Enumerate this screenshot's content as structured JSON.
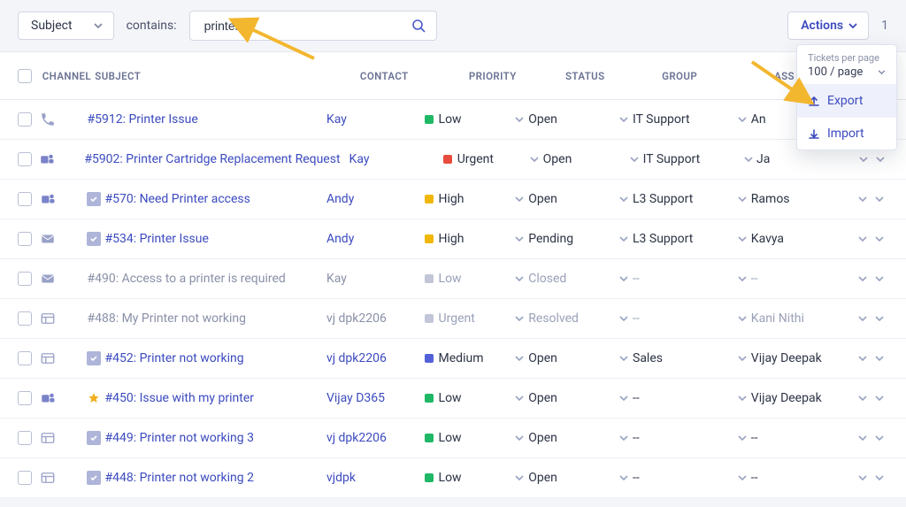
{
  "filter": {
    "field_value": "Subject",
    "operator_label": "contains:",
    "search_value": "printer",
    "search_placeholder": ""
  },
  "actions": {
    "button_label": "Actions",
    "page_counter": "1",
    "popup": {
      "tickets_per_page_label": "Tickets per page",
      "per_page_value": "100 / page",
      "export_label": "Export",
      "import_label": "Import"
    }
  },
  "headers": {
    "channel": "Channel",
    "subject": "Subject",
    "contact": "Contact",
    "priority": "Priority",
    "status": "Status",
    "group": "Group",
    "assigned": "Ass"
  },
  "priority_colors": {
    "Low": "#1fb866",
    "Urgent": "#e74c3c",
    "High": "#f1b708",
    "Medium": "#5261d8"
  },
  "rows": [
    {
      "channel": "phone",
      "lead": "none",
      "subject": "#5912: Printer Issue",
      "contact": "Kay",
      "priority": "Low",
      "status": "Open",
      "group": "IT Support",
      "assigned": "An",
      "muted": false
    },
    {
      "channel": "teams",
      "lead": "none",
      "subject": "#5902: Printer Cartridge Replacement Request",
      "contact": "Kay",
      "priority": "Urgent",
      "status": "Open",
      "group": "IT Support",
      "assigned": "Ja",
      "muted": false
    },
    {
      "channel": "teams",
      "lead": "check",
      "subject": "#570: Need Printer access",
      "contact": "Andy",
      "priority": "High",
      "status": "Open",
      "group": "L3 Support",
      "assigned": "Ramos",
      "muted": false
    },
    {
      "channel": "email",
      "lead": "check",
      "subject": "#534: Printer Issue",
      "contact": "Andy",
      "priority": "High",
      "status": "Pending",
      "group": "L3 Support",
      "assigned": "Kavya",
      "muted": false
    },
    {
      "channel": "email",
      "lead": "none",
      "subject": "#490: Access to a printer is required",
      "contact": "Kay",
      "priority": "Low",
      "status": "Closed",
      "group": "--",
      "assigned": "--",
      "muted": true
    },
    {
      "channel": "panel",
      "lead": "none",
      "subject": "#488: My Printer not working",
      "contact": "vj dpk2206",
      "priority": "Urgent",
      "status": "Resolved",
      "group": "--",
      "assigned": "Kani Nithi",
      "muted": true
    },
    {
      "channel": "panel",
      "lead": "check",
      "subject": "#452: Printer not working",
      "contact": "vj dpk2206",
      "priority": "Medium",
      "status": "Open",
      "group": "Sales",
      "assigned": "Vijay Deepak",
      "muted": false
    },
    {
      "channel": "teams",
      "lead": "star",
      "subject": "#450: Issue with my printer",
      "contact": "Vijay D365",
      "priority": "Low",
      "status": "Open",
      "group": "--",
      "assigned": "Vijay Deepak",
      "muted": false
    },
    {
      "channel": "panel",
      "lead": "check",
      "subject": "#449: Printer not working 3",
      "contact": "vj dpk2206",
      "priority": "Low",
      "status": "Open",
      "group": "--",
      "assigned": "--",
      "muted": false
    },
    {
      "channel": "panel",
      "lead": "check",
      "subject": "#448: Printer not working 2",
      "contact": "vjdpk",
      "priority": "Low",
      "status": "Open",
      "group": "--",
      "assigned": "--",
      "muted": false
    }
  ]
}
